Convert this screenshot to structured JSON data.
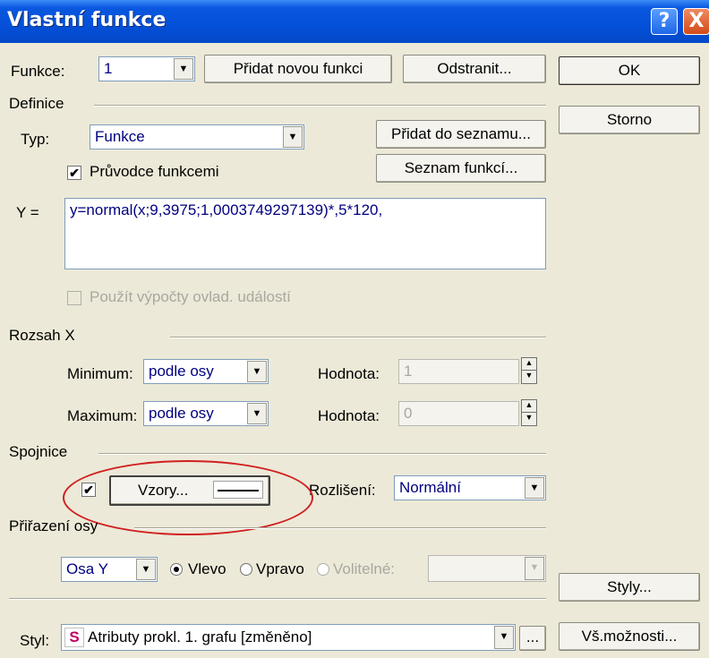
{
  "window": {
    "title": "Vlastní funkce",
    "help_glyph": "?",
    "close_glyph": "X"
  },
  "top": {
    "funkce_label": "Funkce:",
    "funkce_value": "1",
    "add_new": "Přidat novou funkci",
    "remove": "Odstranit...",
    "ok": "OK",
    "cancel": "Storno"
  },
  "definice": {
    "group_label": "Definice",
    "typ_label": "Typ:",
    "typ_value": "Funkce",
    "add_to_list": "Přidat do seznamu...",
    "func_list": "Seznam funkcí...",
    "wizard_label": "Průvodce funkcemi",
    "wizard_checked": true,
    "y_label": "Y =",
    "formula": "y=normal(x;9,3975;1,0003749297139)*,5*120,",
    "events_label": "Použít výpočty ovlad. událostí",
    "events_checked": false
  },
  "rozsah": {
    "group_label": "Rozsah X",
    "min_label": "Minimum:",
    "min_value": "podle osy",
    "min_hodnota_label": "Hodnota:",
    "min_hodnota_value": "1",
    "max_label": "Maximum:",
    "max_value": "podle osy",
    "max_hodnota_label": "Hodnota:",
    "max_hodnota_value": "0"
  },
  "spojnice": {
    "group_label": "Spojnice",
    "checked": true,
    "patterns_label": "Vzory...",
    "resolution_label": "Rozlišení:",
    "resolution_value": "Normální"
  },
  "osy": {
    "group_label": "Přiřazení osy",
    "axis_value": "Osa Y",
    "left_label": "Vlevo",
    "right_label": "Vpravo",
    "optional_label": "Volitelné:",
    "selected": "Vlevo"
  },
  "bottom": {
    "styly_button": "Styly...",
    "styl_label": "Styl:",
    "styl_badge": "S",
    "styl_value": "Atributy prokl. 1. grafu [změněno]",
    "more_button": "...",
    "all_options": "Vš.možnosti..."
  },
  "icons": {
    "dropdown_arrow": "▼",
    "spin_up": "▲",
    "spin_down": "▼",
    "check": "✔"
  },
  "colors": {
    "title_bar": "#0450d8",
    "annotation_ellipse": "#d02020",
    "field_text": "#000080"
  }
}
